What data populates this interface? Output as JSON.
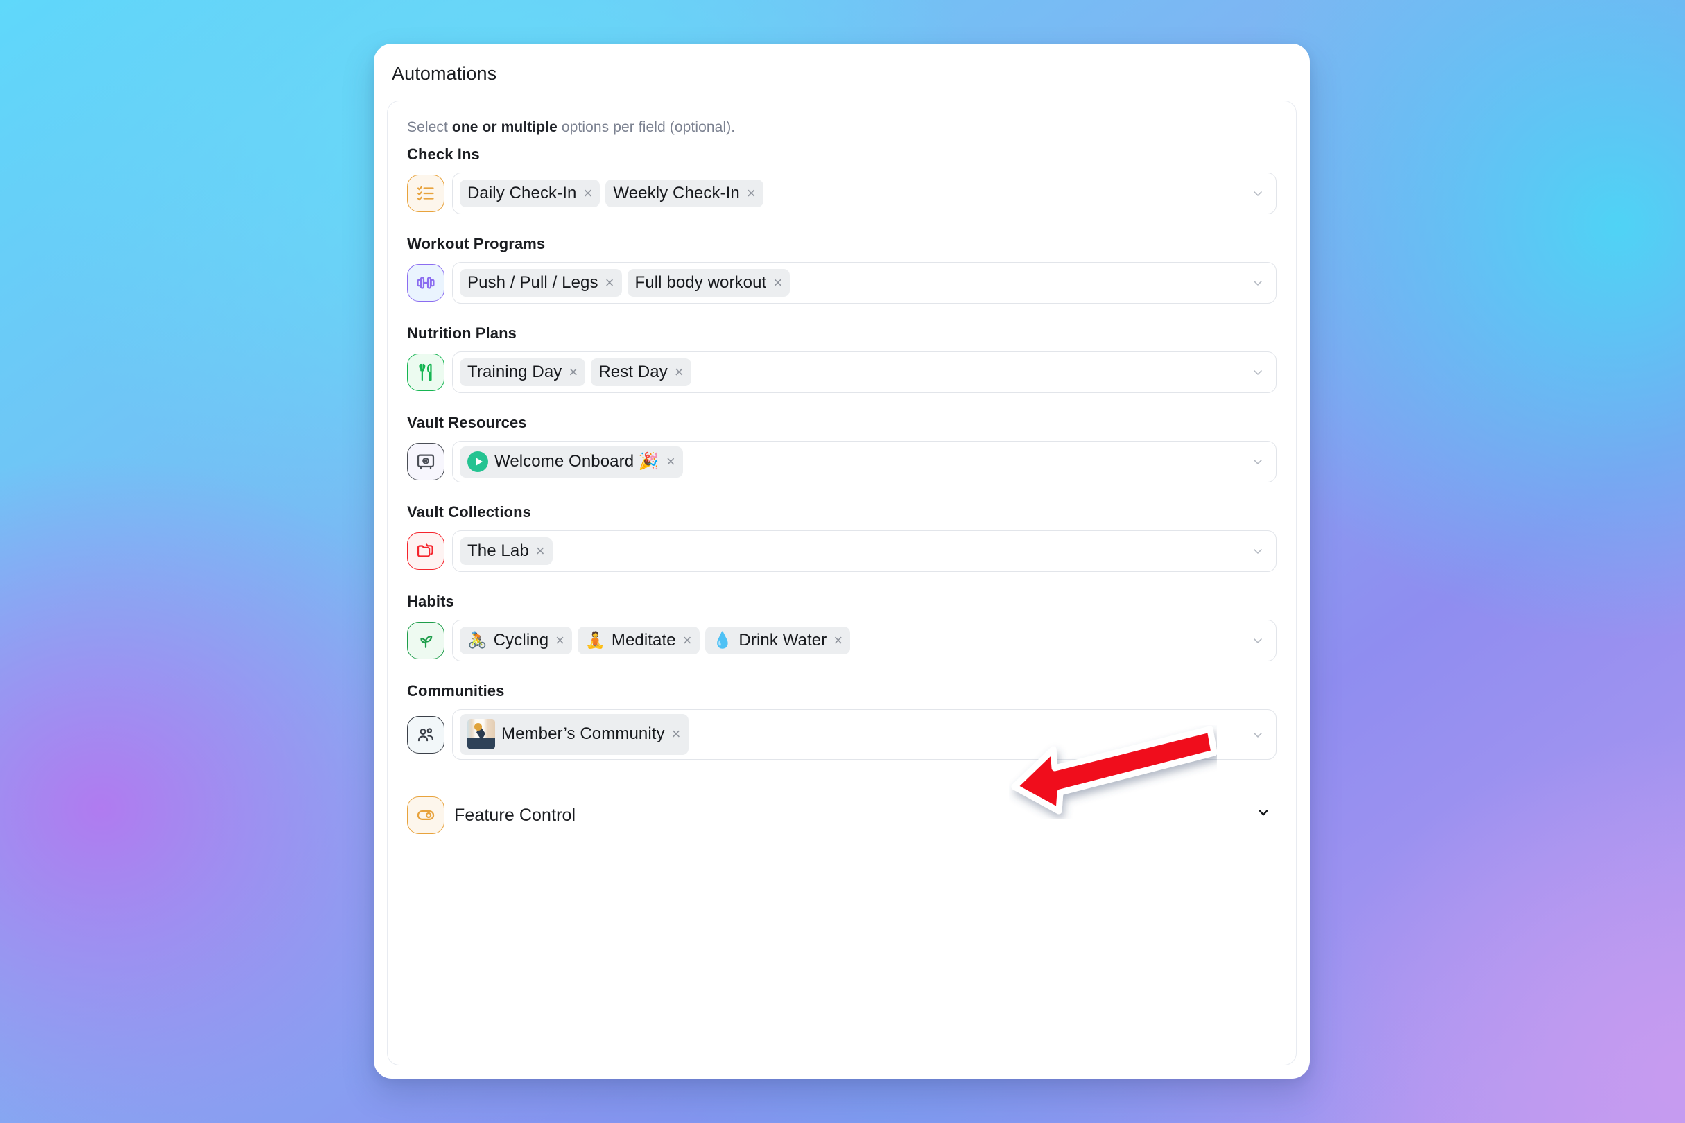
{
  "background": {
    "colors": [
      "#5fd8fa",
      "#7fb3f2",
      "#8f8df0",
      "#b79bf1",
      "#b07bf0"
    ]
  },
  "card": {
    "title": "Automations",
    "hint_prefix": "Select ",
    "hint_bold": "one or multiple",
    "hint_suffix": " options per field (optional)."
  },
  "fields": [
    {
      "label": "Check Ins",
      "icon": "checklist-icon",
      "icon_color": "#e8a33d",
      "icon_bg": "#fdf6ec",
      "chips": [
        {
          "label": "Daily Check-In",
          "remove": "×"
        },
        {
          "label": "Weekly Check-In",
          "remove": "×"
        }
      ],
      "chevron": "chevron-down-icon"
    },
    {
      "label": "Workout Programs",
      "icon": "dumbbell-icon",
      "icon_color": "#8b6df0",
      "icon_bg": "#eaf4fe",
      "chips": [
        {
          "label": "Push / Pull / Legs",
          "remove": "×"
        },
        {
          "label": "Full body workout",
          "remove": "×"
        }
      ],
      "chevron": "chevron-down-icon"
    },
    {
      "label": "Nutrition Plans",
      "icon": "utensils-icon",
      "icon_color": "#16b552",
      "icon_bg": "#ecfbf0",
      "chips": [
        {
          "label": "Training Day",
          "remove": "×"
        },
        {
          "label": "Rest Day",
          "remove": "×"
        }
      ],
      "chevron": "chevron-down-icon"
    },
    {
      "label": "Vault Resources",
      "icon": "vault-icon",
      "icon_color": "#4b4f57",
      "icon_bg": "#f7f6fd",
      "chips": [
        {
          "label": "Welcome Onboard 🎉",
          "remove": "×",
          "leading": "play-icon"
        }
      ],
      "chevron": "chevron-down-icon"
    },
    {
      "label": "Vault Collections",
      "icon": "folders-icon",
      "icon_color": "#f5252d",
      "icon_bg": "#fef3f2",
      "chips": [
        {
          "label": "The Lab",
          "remove": "×"
        }
      ],
      "chevron": "chevron-down-icon"
    },
    {
      "label": "Habits",
      "icon": "sprout-icon",
      "icon_color": "#1f9e4b",
      "icon_bg": "#eefaf1",
      "chips": [
        {
          "label": "Cycling",
          "remove": "×",
          "emoji": "🚴"
        },
        {
          "label": "Meditate",
          "remove": "×",
          "emoji": "🧘"
        },
        {
          "label": "Drink Water",
          "remove": "×",
          "emoji": "💧"
        }
      ],
      "chevron": "chevron-down-icon"
    },
    {
      "label": "Communities",
      "icon": "users-group-icon",
      "icon_color": "#3b4049",
      "icon_bg": "#f2f7f9",
      "chips": [
        {
          "label": "Member’s Community",
          "remove": "×",
          "leading": "community-thumbnail"
        }
      ],
      "chevron": "chevron-down-icon"
    }
  ],
  "feature_control": {
    "label": "Feature Control",
    "icon": "toggle-switch-icon",
    "icon_color": "#e8a33d",
    "icon_bg": "#fdf6ec",
    "chevron": "chevron-down-icon"
  },
  "annotation": {
    "type": "arrow",
    "direction": "left",
    "color": "#f0091e",
    "outline_color": "#ffffff",
    "points_at": "Habits"
  }
}
